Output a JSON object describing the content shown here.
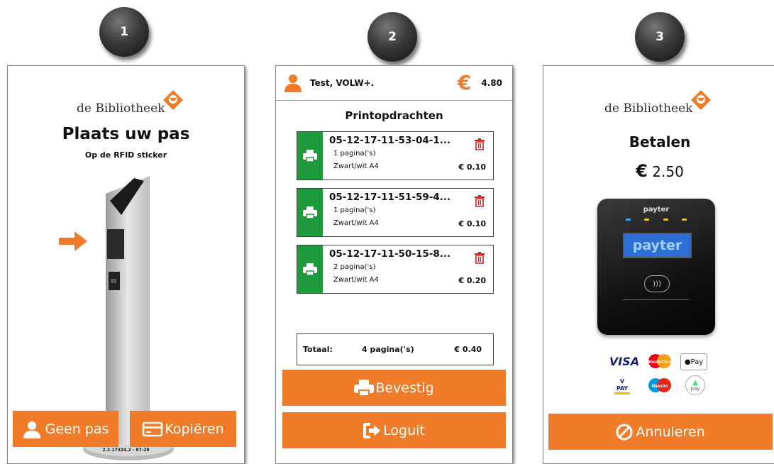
{
  "steps": [
    "1",
    "2",
    "3"
  ],
  "colors": {
    "accent": "#f07c2a",
    "job_icon_bg": "#1e9a3c",
    "trash": "#d42020"
  },
  "kiosk": {
    "logo_text": "de Bibliotheek",
    "title": "Plaats uw pas",
    "subtitle": "Op de RFID sticker",
    "no_card_button": "Geen pas",
    "copy_button": "Kopiëren",
    "version": "2.2.17324.2 - 87-28"
  },
  "print_jobs": {
    "user": "Test, VOLW+.",
    "currency_symbol": "€",
    "balance": "4.80",
    "title": "Printopdrachten",
    "jobs": [
      {
        "name": "05-12-17-11-53-04-1...",
        "pages": "1 pagina('s)",
        "type": "Zwart/wit A4",
        "price": "€ 0.10"
      },
      {
        "name": "05-12-17-11-51-59-4...",
        "pages": "1 pagina('s)",
        "type": "Zwart/wit A4",
        "price": "€ 0.10"
      },
      {
        "name": "05-12-17-11-50-15-8...",
        "pages": "2 pagina('s)",
        "type": "Zwart/wit A4",
        "price": "€ 0.20"
      }
    ],
    "total": {
      "label": "Totaal:",
      "pages": "4 pagina('s)",
      "price": "€ 0.40"
    },
    "confirm_button": "Bevestig",
    "logout_button": "Loguit"
  },
  "payment": {
    "logo_text": "de Bibliotheek",
    "title": "Betalen",
    "currency_symbol": "€",
    "amount": "2.50",
    "terminal_brand": "payter",
    "terminal_screen": "payter",
    "cards": [
      "VISA",
      "MasterCard",
      "Pay",
      "V PAY",
      "Maestro",
      "pay"
    ],
    "cancel_button": "Annuleren"
  }
}
